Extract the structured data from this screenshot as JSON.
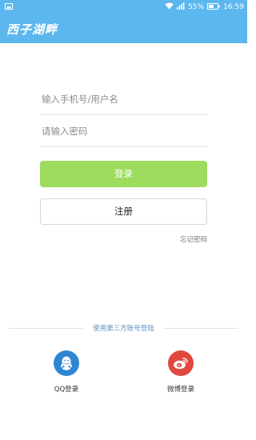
{
  "status_bar": {
    "battery": "55%",
    "time": "16:59"
  },
  "header": {
    "logo_text": "西子湖畔"
  },
  "form": {
    "username_placeholder": "输入手机号/用户名",
    "password_placeholder": "请输入密码",
    "login_label": "登录",
    "register_label": "注册",
    "forgot_label": "忘记密码"
  },
  "third_party": {
    "divider_text": "使用第三方账号登陆",
    "qq_label": "QQ登录",
    "weibo_label": "微博登录"
  },
  "colors": {
    "header_blue": "#5cb7ee",
    "login_green": "#9ddc5d",
    "qq_blue": "#2f86d2",
    "weibo_red": "#e0483e"
  }
}
